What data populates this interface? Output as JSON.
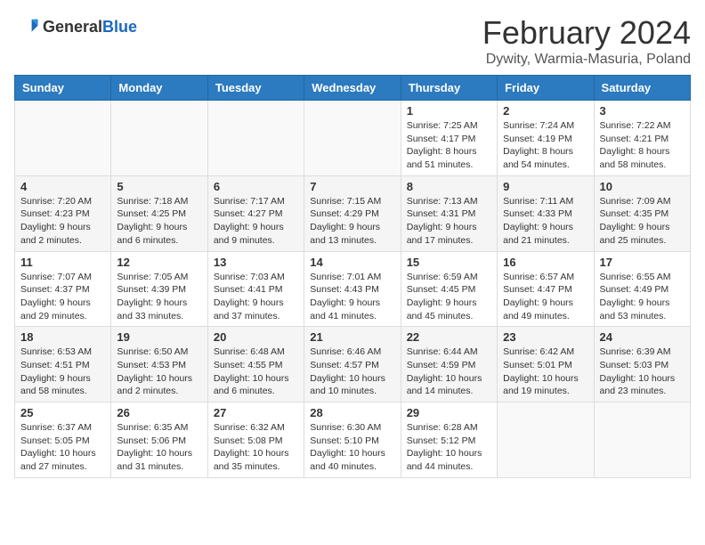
{
  "header": {
    "logo_general": "General",
    "logo_blue": "Blue",
    "title": "February 2024",
    "location": "Dywity, Warmia-Masuria, Poland"
  },
  "weekdays": [
    "Sunday",
    "Monday",
    "Tuesday",
    "Wednesday",
    "Thursday",
    "Friday",
    "Saturday"
  ],
  "weeks": [
    [
      {
        "day": "",
        "info": ""
      },
      {
        "day": "",
        "info": ""
      },
      {
        "day": "",
        "info": ""
      },
      {
        "day": "",
        "info": ""
      },
      {
        "day": "1",
        "info": "Sunrise: 7:25 AM\nSunset: 4:17 PM\nDaylight: 8 hours\nand 51 minutes."
      },
      {
        "day": "2",
        "info": "Sunrise: 7:24 AM\nSunset: 4:19 PM\nDaylight: 8 hours\nand 54 minutes."
      },
      {
        "day": "3",
        "info": "Sunrise: 7:22 AM\nSunset: 4:21 PM\nDaylight: 8 hours\nand 58 minutes."
      }
    ],
    [
      {
        "day": "4",
        "info": "Sunrise: 7:20 AM\nSunset: 4:23 PM\nDaylight: 9 hours\nand 2 minutes."
      },
      {
        "day": "5",
        "info": "Sunrise: 7:18 AM\nSunset: 4:25 PM\nDaylight: 9 hours\nand 6 minutes."
      },
      {
        "day": "6",
        "info": "Sunrise: 7:17 AM\nSunset: 4:27 PM\nDaylight: 9 hours\nand 9 minutes."
      },
      {
        "day": "7",
        "info": "Sunrise: 7:15 AM\nSunset: 4:29 PM\nDaylight: 9 hours\nand 13 minutes."
      },
      {
        "day": "8",
        "info": "Sunrise: 7:13 AM\nSunset: 4:31 PM\nDaylight: 9 hours\nand 17 minutes."
      },
      {
        "day": "9",
        "info": "Sunrise: 7:11 AM\nSunset: 4:33 PM\nDaylight: 9 hours\nand 21 minutes."
      },
      {
        "day": "10",
        "info": "Sunrise: 7:09 AM\nSunset: 4:35 PM\nDaylight: 9 hours\nand 25 minutes."
      }
    ],
    [
      {
        "day": "11",
        "info": "Sunrise: 7:07 AM\nSunset: 4:37 PM\nDaylight: 9 hours\nand 29 minutes."
      },
      {
        "day": "12",
        "info": "Sunrise: 7:05 AM\nSunset: 4:39 PM\nDaylight: 9 hours\nand 33 minutes."
      },
      {
        "day": "13",
        "info": "Sunrise: 7:03 AM\nSunset: 4:41 PM\nDaylight: 9 hours\nand 37 minutes."
      },
      {
        "day": "14",
        "info": "Sunrise: 7:01 AM\nSunset: 4:43 PM\nDaylight: 9 hours\nand 41 minutes."
      },
      {
        "day": "15",
        "info": "Sunrise: 6:59 AM\nSunset: 4:45 PM\nDaylight: 9 hours\nand 45 minutes."
      },
      {
        "day": "16",
        "info": "Sunrise: 6:57 AM\nSunset: 4:47 PM\nDaylight: 9 hours\nand 49 minutes."
      },
      {
        "day": "17",
        "info": "Sunrise: 6:55 AM\nSunset: 4:49 PM\nDaylight: 9 hours\nand 53 minutes."
      }
    ],
    [
      {
        "day": "18",
        "info": "Sunrise: 6:53 AM\nSunset: 4:51 PM\nDaylight: 9 hours\nand 58 minutes."
      },
      {
        "day": "19",
        "info": "Sunrise: 6:50 AM\nSunset: 4:53 PM\nDaylight: 10 hours\nand 2 minutes."
      },
      {
        "day": "20",
        "info": "Sunrise: 6:48 AM\nSunset: 4:55 PM\nDaylight: 10 hours\nand 6 minutes."
      },
      {
        "day": "21",
        "info": "Sunrise: 6:46 AM\nSunset: 4:57 PM\nDaylight: 10 hours\nand 10 minutes."
      },
      {
        "day": "22",
        "info": "Sunrise: 6:44 AM\nSunset: 4:59 PM\nDaylight: 10 hours\nand 14 minutes."
      },
      {
        "day": "23",
        "info": "Sunrise: 6:42 AM\nSunset: 5:01 PM\nDaylight: 10 hours\nand 19 minutes."
      },
      {
        "day": "24",
        "info": "Sunrise: 6:39 AM\nSunset: 5:03 PM\nDaylight: 10 hours\nand 23 minutes."
      }
    ],
    [
      {
        "day": "25",
        "info": "Sunrise: 6:37 AM\nSunset: 5:05 PM\nDaylight: 10 hours\nand 27 minutes."
      },
      {
        "day": "26",
        "info": "Sunrise: 6:35 AM\nSunset: 5:06 PM\nDaylight: 10 hours\nand 31 minutes."
      },
      {
        "day": "27",
        "info": "Sunrise: 6:32 AM\nSunset: 5:08 PM\nDaylight: 10 hours\nand 35 minutes."
      },
      {
        "day": "28",
        "info": "Sunrise: 6:30 AM\nSunset: 5:10 PM\nDaylight: 10 hours\nand 40 minutes."
      },
      {
        "day": "29",
        "info": "Sunrise: 6:28 AM\nSunset: 5:12 PM\nDaylight: 10 hours\nand 44 minutes."
      },
      {
        "day": "",
        "info": ""
      },
      {
        "day": "",
        "info": ""
      }
    ]
  ]
}
